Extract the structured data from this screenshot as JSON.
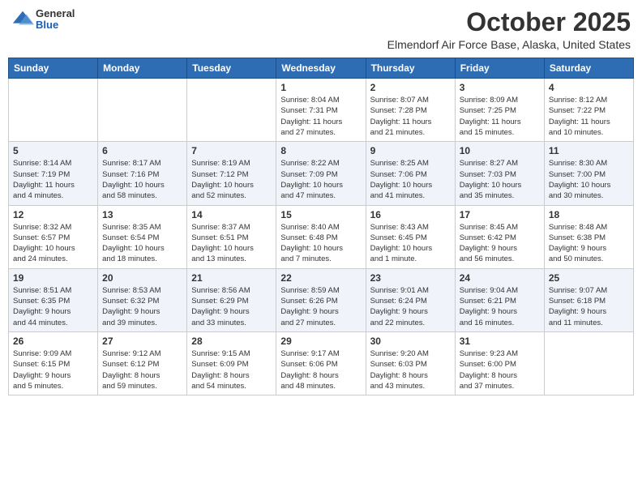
{
  "logo": {
    "general": "General",
    "blue": "Blue"
  },
  "header": {
    "title": "October 2025",
    "subtitle": "Elmendorf Air Force Base, Alaska, United States"
  },
  "days_of_week": [
    "Sunday",
    "Monday",
    "Tuesday",
    "Wednesday",
    "Thursday",
    "Friday",
    "Saturday"
  ],
  "weeks": [
    [
      {
        "day": "",
        "info": ""
      },
      {
        "day": "",
        "info": ""
      },
      {
        "day": "",
        "info": ""
      },
      {
        "day": "1",
        "info": "Sunrise: 8:04 AM\nSunset: 7:31 PM\nDaylight: 11 hours\nand 27 minutes."
      },
      {
        "day": "2",
        "info": "Sunrise: 8:07 AM\nSunset: 7:28 PM\nDaylight: 11 hours\nand 21 minutes."
      },
      {
        "day": "3",
        "info": "Sunrise: 8:09 AM\nSunset: 7:25 PM\nDaylight: 11 hours\nand 15 minutes."
      },
      {
        "day": "4",
        "info": "Sunrise: 8:12 AM\nSunset: 7:22 PM\nDaylight: 11 hours\nand 10 minutes."
      }
    ],
    [
      {
        "day": "5",
        "info": "Sunrise: 8:14 AM\nSunset: 7:19 PM\nDaylight: 11 hours\nand 4 minutes."
      },
      {
        "day": "6",
        "info": "Sunrise: 8:17 AM\nSunset: 7:16 PM\nDaylight: 10 hours\nand 58 minutes."
      },
      {
        "day": "7",
        "info": "Sunrise: 8:19 AM\nSunset: 7:12 PM\nDaylight: 10 hours\nand 52 minutes."
      },
      {
        "day": "8",
        "info": "Sunrise: 8:22 AM\nSunset: 7:09 PM\nDaylight: 10 hours\nand 47 minutes."
      },
      {
        "day": "9",
        "info": "Sunrise: 8:25 AM\nSunset: 7:06 PM\nDaylight: 10 hours\nand 41 minutes."
      },
      {
        "day": "10",
        "info": "Sunrise: 8:27 AM\nSunset: 7:03 PM\nDaylight: 10 hours\nand 35 minutes."
      },
      {
        "day": "11",
        "info": "Sunrise: 8:30 AM\nSunset: 7:00 PM\nDaylight: 10 hours\nand 30 minutes."
      }
    ],
    [
      {
        "day": "12",
        "info": "Sunrise: 8:32 AM\nSunset: 6:57 PM\nDaylight: 10 hours\nand 24 minutes."
      },
      {
        "day": "13",
        "info": "Sunrise: 8:35 AM\nSunset: 6:54 PM\nDaylight: 10 hours\nand 18 minutes."
      },
      {
        "day": "14",
        "info": "Sunrise: 8:37 AM\nSunset: 6:51 PM\nDaylight: 10 hours\nand 13 minutes."
      },
      {
        "day": "15",
        "info": "Sunrise: 8:40 AM\nSunset: 6:48 PM\nDaylight: 10 hours\nand 7 minutes."
      },
      {
        "day": "16",
        "info": "Sunrise: 8:43 AM\nSunset: 6:45 PM\nDaylight: 10 hours\nand 1 minute."
      },
      {
        "day": "17",
        "info": "Sunrise: 8:45 AM\nSunset: 6:42 PM\nDaylight: 9 hours\nand 56 minutes."
      },
      {
        "day": "18",
        "info": "Sunrise: 8:48 AM\nSunset: 6:38 PM\nDaylight: 9 hours\nand 50 minutes."
      }
    ],
    [
      {
        "day": "19",
        "info": "Sunrise: 8:51 AM\nSunset: 6:35 PM\nDaylight: 9 hours\nand 44 minutes."
      },
      {
        "day": "20",
        "info": "Sunrise: 8:53 AM\nSunset: 6:32 PM\nDaylight: 9 hours\nand 39 minutes."
      },
      {
        "day": "21",
        "info": "Sunrise: 8:56 AM\nSunset: 6:29 PM\nDaylight: 9 hours\nand 33 minutes."
      },
      {
        "day": "22",
        "info": "Sunrise: 8:59 AM\nSunset: 6:26 PM\nDaylight: 9 hours\nand 27 minutes."
      },
      {
        "day": "23",
        "info": "Sunrise: 9:01 AM\nSunset: 6:24 PM\nDaylight: 9 hours\nand 22 minutes."
      },
      {
        "day": "24",
        "info": "Sunrise: 9:04 AM\nSunset: 6:21 PM\nDaylight: 9 hours\nand 16 minutes."
      },
      {
        "day": "25",
        "info": "Sunrise: 9:07 AM\nSunset: 6:18 PM\nDaylight: 9 hours\nand 11 minutes."
      }
    ],
    [
      {
        "day": "26",
        "info": "Sunrise: 9:09 AM\nSunset: 6:15 PM\nDaylight: 9 hours\nand 5 minutes."
      },
      {
        "day": "27",
        "info": "Sunrise: 9:12 AM\nSunset: 6:12 PM\nDaylight: 8 hours\nand 59 minutes."
      },
      {
        "day": "28",
        "info": "Sunrise: 9:15 AM\nSunset: 6:09 PM\nDaylight: 8 hours\nand 54 minutes."
      },
      {
        "day": "29",
        "info": "Sunrise: 9:17 AM\nSunset: 6:06 PM\nDaylight: 8 hours\nand 48 minutes."
      },
      {
        "day": "30",
        "info": "Sunrise: 9:20 AM\nSunset: 6:03 PM\nDaylight: 8 hours\nand 43 minutes."
      },
      {
        "day": "31",
        "info": "Sunrise: 9:23 AM\nSunset: 6:00 PM\nDaylight: 8 hours\nand 37 minutes."
      },
      {
        "day": "",
        "info": ""
      }
    ]
  ]
}
